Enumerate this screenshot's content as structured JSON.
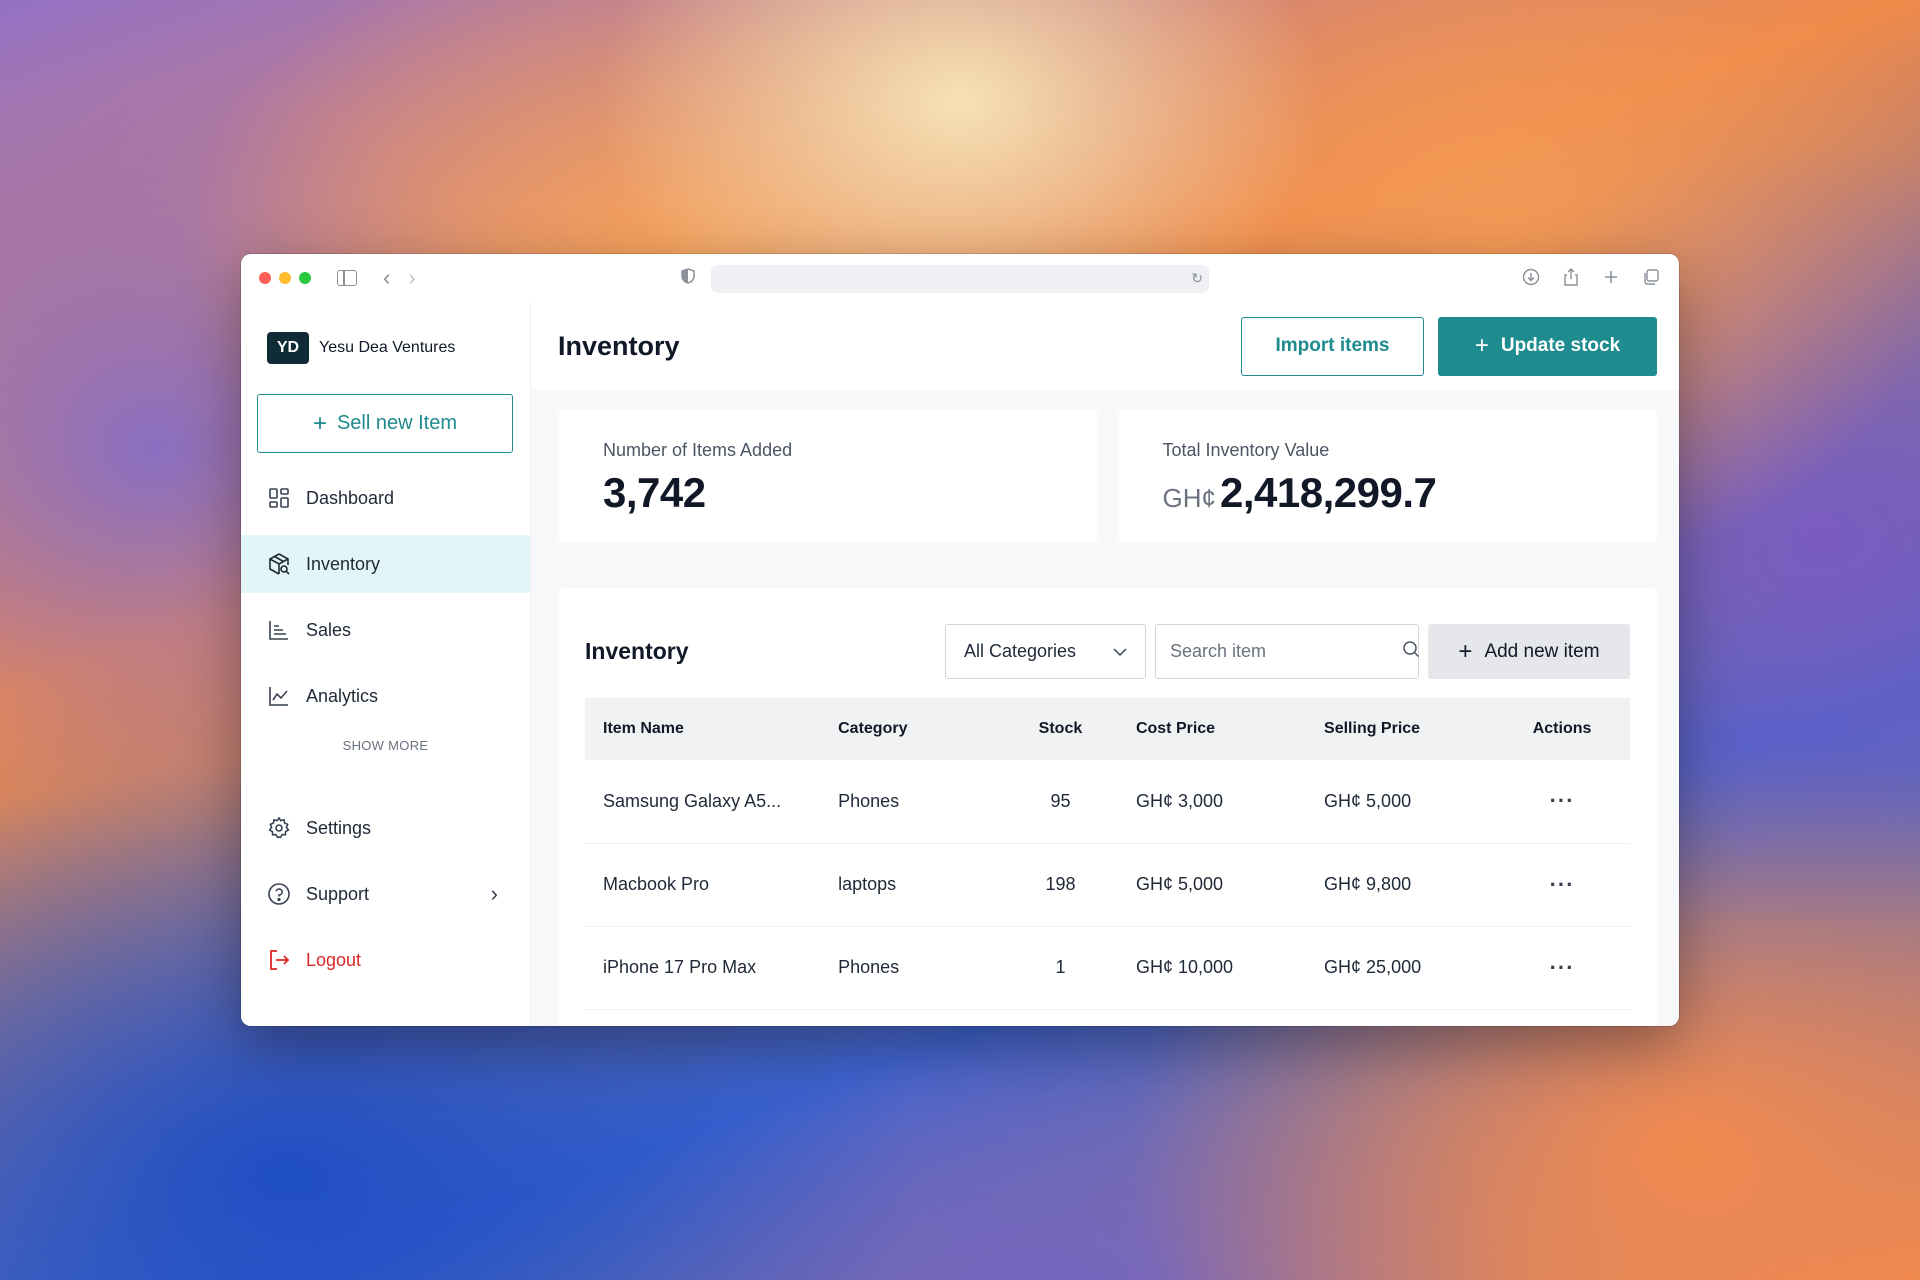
{
  "brand": {
    "initials": "YD",
    "name": "Yesu Dea Ventures"
  },
  "sidebar": {
    "sell_button": "Sell new Item",
    "items": [
      {
        "label": "Dashboard",
        "icon": "dashboard-icon"
      },
      {
        "label": "Inventory",
        "icon": "inventory-icon",
        "active": true
      },
      {
        "label": "Sales",
        "icon": "sales-icon"
      },
      {
        "label": "Analytics",
        "icon": "analytics-icon"
      }
    ],
    "show_more": "SHOW MORE",
    "bottom": [
      {
        "label": "Settings",
        "icon": "gear-icon"
      },
      {
        "label": "Support",
        "icon": "help-icon"
      },
      {
        "label": "Logout",
        "icon": "logout-icon"
      }
    ]
  },
  "header": {
    "title": "Inventory",
    "import_button": "Import items",
    "update_button": "Update stock"
  },
  "stats": {
    "items_added": {
      "label": "Number of Items Added",
      "value": "3,742"
    },
    "total_value": {
      "label": "Total Inventory Value",
      "currency": "GH¢",
      "value": "2,418,299.7"
    }
  },
  "table": {
    "title": "Inventory",
    "category_filter": "All Categories",
    "search_placeholder": "Search item",
    "add_button": "Add new item",
    "columns": [
      "Item Name",
      "Category",
      "Stock",
      "Cost Price",
      "Selling Price",
      "Actions"
    ],
    "rows": [
      {
        "name": "Samsung Galaxy A5...",
        "category": "Phones",
        "stock": "95",
        "cost": "GH¢ 3,000",
        "selling": "GH¢ 5,000"
      },
      {
        "name": "Macbook Pro",
        "category": "laptops",
        "stock": "198",
        "cost": "GH¢ 5,000",
        "selling": "GH¢ 9,800"
      },
      {
        "name": "iPhone 17 Pro Max",
        "category": "Phones",
        "stock": "1",
        "cost": "GH¢ 10,000",
        "selling": "GH¢ 25,000"
      }
    ]
  },
  "colors": {
    "accent": "#1e8b8f",
    "active_bg": "#e3f6f7",
    "logout": "#dc2626",
    "brand_badge": "#0f2b36"
  }
}
